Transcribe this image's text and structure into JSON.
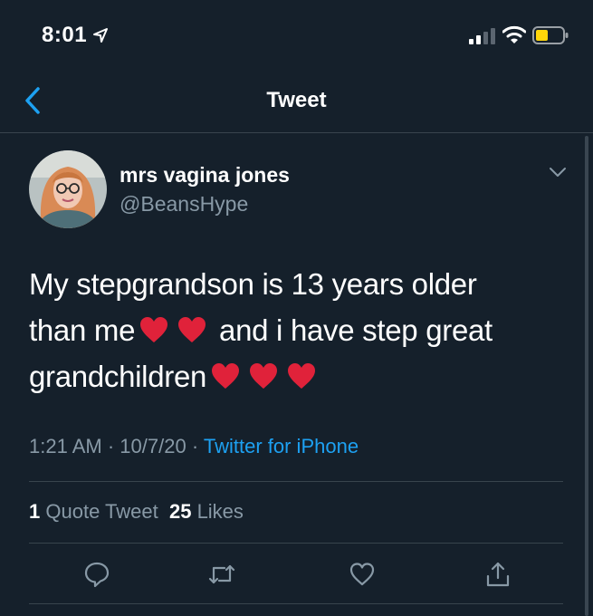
{
  "status_bar": {
    "time": "8:01"
  },
  "nav": {
    "title": "Tweet"
  },
  "tweet": {
    "display_name": "mrs vagina jones",
    "handle": "@BeansHype",
    "text_line1": "My stepgrandson is 13 years older",
    "text_line2_a": "than me",
    "text_line2_b": "and i have step great",
    "text_line3": "grandchildren",
    "time": "1:21 AM",
    "sep1": "·",
    "date": "10/7/20",
    "sep2": "·",
    "source": "Twitter for iPhone",
    "quote_count": "1",
    "quote_label": "Quote Tweet",
    "like_count": "25",
    "like_label": "Likes"
  },
  "icons": {
    "back": "chevron-left-icon",
    "caret": "chevron-down-icon",
    "reply": "reply-icon",
    "retweet": "retweet-icon",
    "like": "heart-outline-icon",
    "share": "share-icon",
    "emoji": "red-heart-emoji"
  },
  "colors": {
    "background": "#15202b",
    "accent": "#1da1f2",
    "secondary_text": "#8899a6",
    "divider": "#38444d",
    "heart_emoji": "#e0223a",
    "battery_low": "#ffd60a"
  }
}
